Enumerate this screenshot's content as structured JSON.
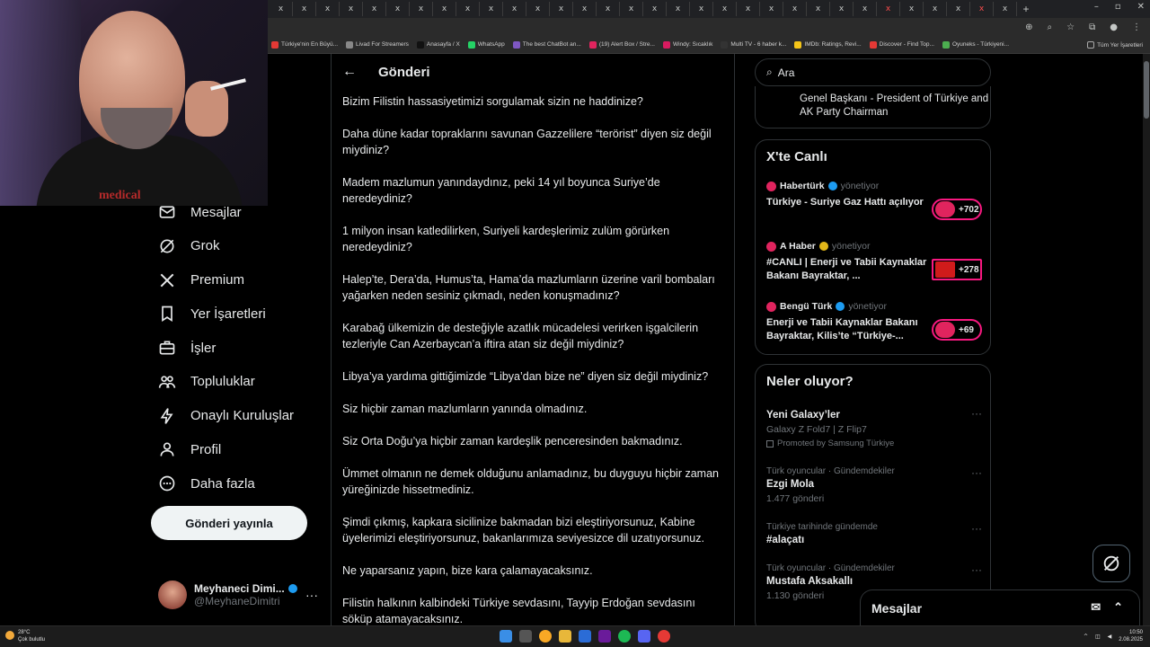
{
  "browser": {
    "tabs": [
      "x",
      "x",
      "x",
      "x",
      "x",
      "x",
      "x",
      "x",
      "x",
      "x",
      "x",
      "x",
      "x",
      "x",
      "x",
      "x",
      "x",
      "x",
      "x",
      "x",
      "x",
      "x",
      "x",
      "x",
      "x",
      "x",
      "x",
      "x",
      "x",
      "x",
      "x",
      "x"
    ],
    "new_tab": "+",
    "bookmarks": [
      {
        "label": "Türkiye'nin En Büyü...",
        "color": "#e53935"
      },
      {
        "label": "Livad For Streamers",
        "color": "#888888"
      },
      {
        "label": "Anasayfa / X",
        "color": "#111111"
      },
      {
        "label": "WhatsApp",
        "color": "#25d366"
      },
      {
        "label": "The best ChatBot an...",
        "color": "#7e57c2"
      },
      {
        "label": "(19) Alert Box / Stre...",
        "color": "#e0245e"
      },
      {
        "label": "Windy: Sıcaklık",
        "color": "#d81b60"
      },
      {
        "label": "Multi TV - 6 haber k...",
        "color": "#333333"
      },
      {
        "label": "IMDb: Ratings, Revi...",
        "color": "#f5c518"
      },
      {
        "label": "Discover - Find Top...",
        "color": "#e53935"
      },
      {
        "label": "Oyuneks - Türkiyeni...",
        "color": "#4caf50"
      }
    ],
    "all_bookmarks": "Tüm Yer İşaretleri"
  },
  "webcam": {
    "shirt_text": "medical"
  },
  "nav": {
    "items": [
      {
        "label": "Mesajlar",
        "icon": "mail-icon"
      },
      {
        "label": "Grok",
        "icon": "grok-icon"
      },
      {
        "label": "Premium",
        "icon": "x-logo-icon"
      },
      {
        "label": "Yer İşaretleri",
        "icon": "bookmark-icon"
      },
      {
        "label": "İşler",
        "icon": "briefcase-icon"
      },
      {
        "label": "Topluluklar",
        "icon": "people-icon"
      },
      {
        "label": "Onaylı Kuruluşlar",
        "icon": "lightning-icon"
      },
      {
        "label": "Profil",
        "icon": "person-icon"
      },
      {
        "label": "Daha fazla",
        "icon": "more-circle-icon"
      }
    ],
    "post_button": "Gönderi yayınla",
    "profile": {
      "name": "Meyhaneci Dimi...",
      "handle": "@MeyhaneDimitri",
      "more": "···"
    }
  },
  "main": {
    "title": "Gönderi",
    "paragraphs": [
      "Bizim Filistin hassasiyetimizi sorgulamak sizin ne haddinize?",
      "Daha düne kadar topraklarını savunan Gazzelilere “terörist” diyen siz değil miydiniz?",
      "Madem mazlumun yanındaydınız, peki 14 yıl boyunca Suriye’de neredeydiniz?",
      "1 milyon insan katledilirken, Suriyeli kardeşlerimiz zulüm görürken neredeydiniz?",
      "Halep’te, Dera’da, Humus’ta, Hama’da mazlumların üzerine varil bombaları yağarken neden sesiniz çıkmadı, neden konuşmadınız?",
      "Karabağ ülkemizin de desteğiyle azatlık mücadelesi verirken işgalcilerin tezleriyle Can Azerbaycan’a iftira atan siz değil miydiniz?",
      "Libya’ya yardıma gittiğimizde “Libya’dan bize ne” diyen siz değil miydiniz?",
      "Siz hiçbir zaman mazlumların yanında olmadınız.",
      "Siz Orta Doğu’ya hiçbir zaman kardeşlik penceresinden bakmadınız.",
      "Ümmet olmanın ne demek olduğunu anlamadınız, bu duyguyu hiçbir zaman yüreğinizde hissetmediniz.",
      "Şimdi çıkmış, kapkara sicilinize bakmadan bizi eleştiriyorsunuz, Kabine üyelerimizi eleştiriyorsunuz, bakanlarımıza seviyesizce dil uzatıyorsunuz.",
      "Ne yaparsanız yapın, bize kara çalamayacaksınız.",
      "Filistin halkının kalbindeki Türkiye sevdasını, Tayyip Erdoğan sevdasını söküp atamayacaksınız."
    ]
  },
  "right": {
    "search_placeholder": "Ara",
    "who_text": "Genel Başkanı - President of Türkiye and AK Party Chairman",
    "live": {
      "title": "X'te Canlı",
      "items": [
        {
          "source": "Habertürk",
          "role": "yönetiyor",
          "text": "Türkiye - Suriye Gaz Hattı açılıyor",
          "count": "+702"
        },
        {
          "source": "A Haber",
          "role": "yönetiyor",
          "text": "#CANLI | Enerji ve Tabii Kaynaklar Bakanı Bayraktar, ...",
          "count": "+278"
        },
        {
          "source": "Bengü Türk",
          "role": "yönetiyor",
          "text": "Enerji ve Tabii Kaynaklar Bakanı Bayraktar, Kilis’te “Türkiye-...",
          "count": "+69"
        }
      ]
    },
    "trends": {
      "title": "Neler oluyor?",
      "items": [
        {
          "meta": "",
          "title": "Yeni Galaxy’ler",
          "sub": "Galaxy Z Fold7 | Z Flip7",
          "promo": "Promoted by Samsung Türkiye"
        },
        {
          "meta": "Türk oyuncular · Gündemdekiler",
          "title": "Ezgi Mola",
          "sub": "1.477 gönderi",
          "promo": ""
        },
        {
          "meta": "Türkiye tarihinde gündemde",
          "title": "#alaçatı",
          "sub": "",
          "promo": ""
        },
        {
          "meta": "Türk oyuncular · Gündemdekiler",
          "title": "Mustafa Aksakallı",
          "sub": "1.130 gönderi",
          "promo": ""
        }
      ],
      "more": "···"
    }
  },
  "messages": {
    "title": "Mesajlar"
  },
  "taskbar": {
    "temp": "28°C",
    "weather": "Çok bulutlu",
    "time": "10:50",
    "date": "2.08.2025"
  },
  "colors": {
    "accent": "#1d9bf0",
    "live": "#f91880",
    "muted": "#71767b",
    "border": "#2f3336"
  }
}
